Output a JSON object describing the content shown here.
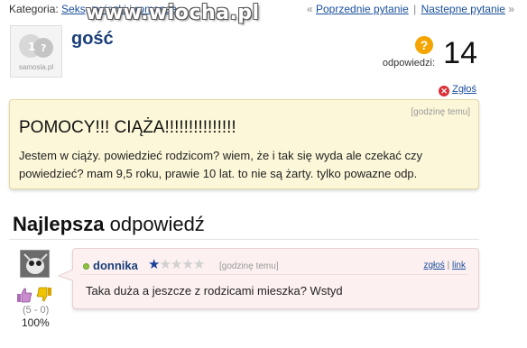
{
  "topbar": {
    "category_label": "Kategoria:",
    "category_link": "Seks, związki i romanse",
    "nav_prev_arrow": "«",
    "nav_prev": "Poprzednie pytanie",
    "nav_sep": "|",
    "nav_next": "Nastepne pytanie",
    "nav_next_arrow": "»"
  },
  "watermark": "www.wiocha.pl",
  "question": {
    "avatar_logo": "samosia.pl",
    "author": "gość",
    "answers_label": "odpowiedzi:",
    "answers_count": "14",
    "report_label": "Zgłoś",
    "time": "[godzinę temu]",
    "title": "POMOCY!!! CIĄŻA!!!!!!!!!!!!!!!",
    "body": "Jestem w ciąży. powiedzieć rodzicom? wiem, że i tak się wyda ale czekać czy powiedzieć? mam 9,5 roku, prawie 10 lat. to nie są żarty. tylko powazne odp."
  },
  "best_answer": {
    "heading_bold": "Najlepsza",
    "heading_rest": " odpowiedź",
    "author": "donnika",
    "rating_stars": 1,
    "rating_max": 5,
    "time": "[godzinę temu]",
    "report_link": "zgłoś",
    "link_sep": "|",
    "link_link": "link",
    "text": "Taka duża a jeszcze z rodzicami mieszka? Wstyd",
    "vote_count": "(5 - 0)",
    "vote_percent": "100%"
  },
  "colors": {
    "question_bg": "#fcf7d8",
    "answer_bg": "#fcf0f0",
    "link": "#1a4f9c",
    "author": "#1a3f7a"
  }
}
